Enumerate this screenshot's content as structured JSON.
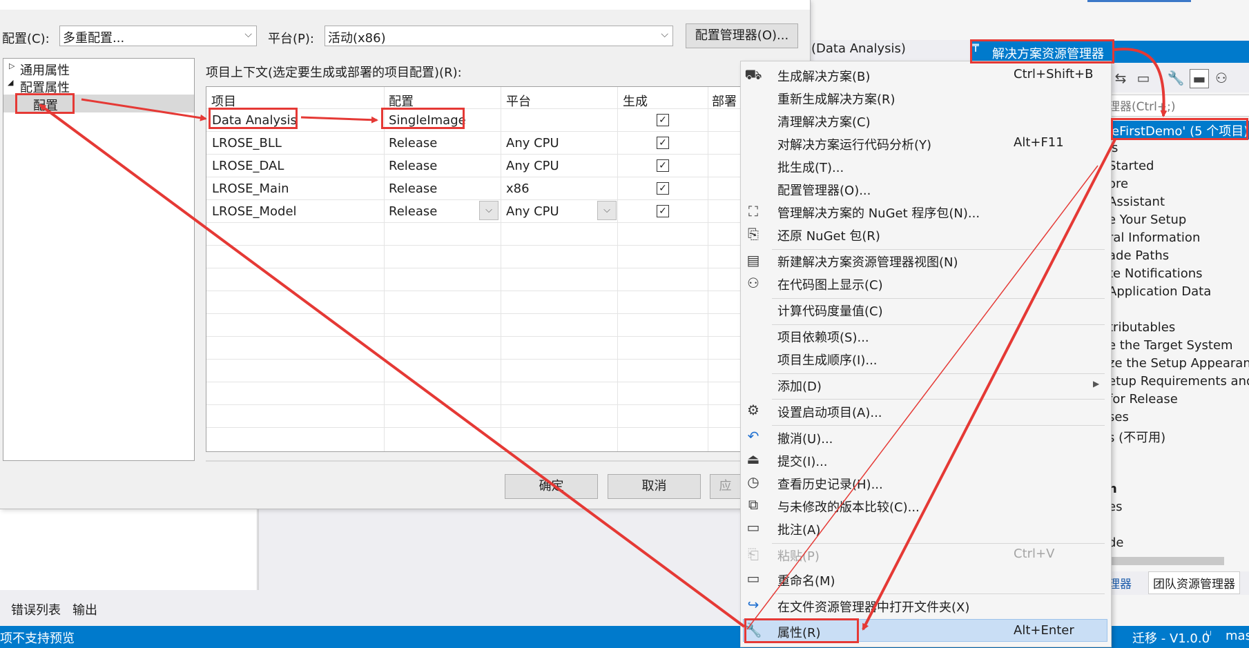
{
  "dialog": {
    "config_label": "配置(C):",
    "config_value": "多重配置...",
    "platform_label": "平台(P):",
    "platform_value": "活动(x86)",
    "config_manager_button": "配置管理器(O)...",
    "tree": {
      "common": "通用属性",
      "config_props": "配置属性",
      "config": "配置"
    },
    "grid_title": "项目上下文(选定要生成或部署的项目配置)(R):",
    "columns": [
      "项目",
      "配置",
      "平台",
      "生成",
      "部署"
    ],
    "rows": [
      {
        "project": "Data Analysis",
        "config": "SingleImage",
        "platform": "",
        "build": true
      },
      {
        "project": "LROSE_BLL",
        "config": "Release",
        "platform": "Any CPU",
        "build": true
      },
      {
        "project": "LROSE_DAL",
        "config": "Release",
        "platform": "Any CPU",
        "build": true
      },
      {
        "project": "LROSE_Main",
        "config": "Release",
        "platform": "x86",
        "build": true
      },
      {
        "project": "LROSE_Model",
        "config": "Release",
        "platform": "Any CPU",
        "build": true
      }
    ],
    "ok_button": "确定",
    "cancel_button": "取消",
    "apply_button": "应"
  },
  "context_menu": {
    "items": [
      {
        "label": "生成解决方案(B)",
        "shortcut": "Ctrl+Shift+B",
        "icon": "build-solution-icon"
      },
      {
        "label": "重新生成解决方案(R)",
        "shortcut": ""
      },
      {
        "label": "清理解决方案(C)",
        "shortcut": ""
      },
      {
        "label": "对解决方案运行代码分析(Y)",
        "shortcut": "Alt+F11"
      },
      {
        "label": "批生成(T)...",
        "shortcut": ""
      },
      {
        "label": "配置管理器(O)...",
        "shortcut": ""
      },
      {
        "label": "管理解决方案的 NuGet 程序包(N)...",
        "shortcut": "",
        "icon": "nuget-icon"
      },
      {
        "label": "还原 NuGet 包(R)",
        "shortcut": "",
        "icon": "restore-icon"
      },
      {
        "label": "新建解决方案资源管理器视图(N)",
        "shortcut": "",
        "icon": "new-view-icon"
      },
      {
        "label": "在代码图上显示(C)",
        "shortcut": "",
        "icon": "code-map-icon"
      },
      {
        "label": "计算代码度量值(C)",
        "shortcut": ""
      },
      {
        "label": "项目依赖项(S)...",
        "shortcut": ""
      },
      {
        "label": "项目生成顺序(I)...",
        "shortcut": ""
      },
      {
        "label": "添加(D)",
        "shortcut": ""
      },
      {
        "label": "设置启动项目(A)...",
        "shortcut": "",
        "icon": "gear-icon"
      },
      {
        "label": "撤消(U)...",
        "shortcut": "",
        "icon": "undo-icon"
      },
      {
        "label": "提交(I)...",
        "shortcut": "",
        "icon": "commit-icon"
      },
      {
        "label": "查看历史记录(H)...",
        "shortcut": "",
        "icon": "history-icon"
      },
      {
        "label": "与未修改的版本比较(C)...",
        "shortcut": "",
        "icon": "compare-icon"
      },
      {
        "label": "批注(A)",
        "shortcut": "",
        "icon": "annotate-icon"
      },
      {
        "label": "粘贴(P)",
        "shortcut": "Ctrl+V",
        "icon": "paste-icon",
        "disabled": true
      },
      {
        "label": "重命名(M)",
        "shortcut": "",
        "icon": "rename-icon"
      },
      {
        "label": "在文件资源管理器中打开文件夹(X)",
        "shortcut": "",
        "icon": "open-folder-icon"
      },
      {
        "label": "属性(R)",
        "shortcut": "Alt+Enter",
        "icon": "wrench-icon"
      }
    ]
  },
  "vs": {
    "tab_title": "(Data Analysis)",
    "solution_explorer_title": "解决方案资源管理器",
    "search_placeholder": "理器(Ctrl+;)",
    "solution_node": "eFirstDemo' (5 个项目)",
    "tree_items": [
      "is",
      "Started",
      "ore",
      "Assistant",
      "e Your Setup",
      "ral Information",
      "ade Paths",
      "te Notifications",
      "Application Data",
      "tributables",
      "e the Target System",
      "ze the Setup Appearance",
      "etup Requirements and",
      "for Release",
      "ses",
      "s (不可用)",
      "n",
      "es",
      "de"
    ],
    "se_tab": "理器",
    "team_tab": "团队资源管理器",
    "error_list_tab": "错误列表",
    "output_tab": "输出",
    "status_left": "项不支持预览",
    "status_right": "迁移 - V1.0.0",
    "status_branch": "mas"
  },
  "annotation_color": "#e53935",
  "accent_color": "#007acc"
}
